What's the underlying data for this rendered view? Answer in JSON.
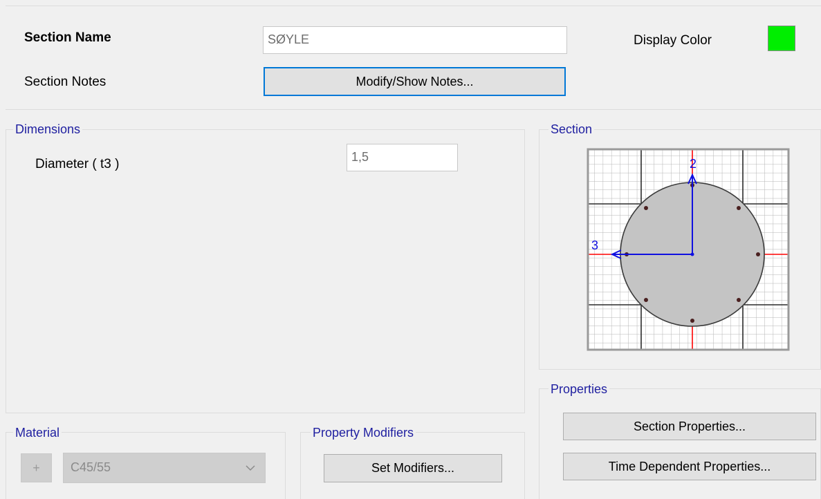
{
  "header": {
    "section_name_label": "Section Name",
    "section_name_value": "SØYLE",
    "display_color_label": "Display Color",
    "display_color": "#00ee00",
    "section_notes_label": "Section Notes",
    "notes_button": "Modify/Show Notes..."
  },
  "dimensions": {
    "title": "Dimensions",
    "diameter_label": "Diameter  ( t3 )",
    "diameter_value": "1,5"
  },
  "section_preview": {
    "title": "Section",
    "axis_2_label": "2",
    "axis_3_label": "3",
    "fill_color": "#c4c4c4",
    "axis_color": "#1010e0",
    "centerline_color": "#ff0000"
  },
  "material": {
    "title": "Material",
    "add_label": "+",
    "selected": "C45/55"
  },
  "property_modifiers": {
    "title": "Property Modifiers",
    "button": "Set Modifiers..."
  },
  "properties": {
    "title": "Properties",
    "section_properties_button": "Section Properties...",
    "time_dependent_button": "Time Dependent Properties..."
  }
}
